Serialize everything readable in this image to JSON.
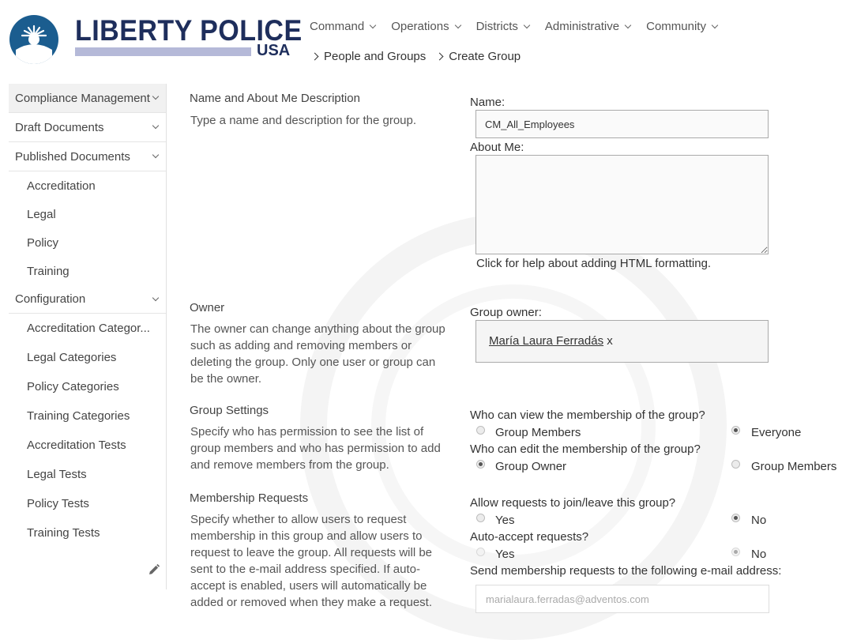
{
  "header": {
    "brand_title": "LIBERTY POLICE",
    "brand_sub": "USA",
    "nav": [
      {
        "label": "Command"
      },
      {
        "label": "Operations"
      },
      {
        "label": "Districts"
      },
      {
        "label": "Administrative"
      },
      {
        "label": "Community"
      }
    ],
    "breadcrumb": [
      {
        "label": "People and Groups"
      },
      {
        "label": "Create Group"
      }
    ]
  },
  "sidebar": {
    "compliance": "Compliance Management",
    "draft": "Draft Documents",
    "published": "Published Documents",
    "published_items": [
      {
        "label": "Accreditation"
      },
      {
        "label": "Legal"
      },
      {
        "label": "Policy"
      },
      {
        "label": "Training"
      }
    ],
    "configuration": "Configuration",
    "config_items": [
      {
        "label": "Accreditation Categor..."
      },
      {
        "label": "Legal Categories"
      },
      {
        "label": "Policy Categories"
      },
      {
        "label": "Training Categories"
      },
      {
        "label": "Accreditation Tests"
      },
      {
        "label": "Legal Tests"
      },
      {
        "label": "Policy Tests"
      },
      {
        "label": "Training Tests"
      }
    ]
  },
  "sections": {
    "name": {
      "title": "Name and About Me Description",
      "desc": "Type a name and description for the group."
    },
    "owner": {
      "title": "Owner",
      "desc": "The owner can change anything about the group such as adding and removing members or deleting the group. Only one user or group can be the owner."
    },
    "settings": {
      "title": "Group Settings",
      "desc": "Specify who has permission to see the list of group members and who has permission to add and remove members from the group."
    },
    "requests": {
      "title": "Membership Requests",
      "desc": "Specify whether to allow users to request membership in this group and allow users to request to leave the group. All requests will be sent to the e-mail address specified. If auto-accept is enabled, users will automatically be added or removed when they make a request."
    }
  },
  "form": {
    "name_label": "Name:",
    "name_value": "CM_All_Employees",
    "about_label": "About Me:",
    "about_value": "",
    "help_link": "Click for help about adding HTML formatting.",
    "owner_label": "Group owner:",
    "owner_value": "María Laura Ferradás",
    "owner_remove": "x",
    "view_question": "Who can view the membership of the group?",
    "view_options": [
      "Group Members",
      "Everyone"
    ],
    "view_selected": "Everyone",
    "edit_question": "Who can edit the membership of the group?",
    "edit_options": [
      "Group Owner",
      "Group Members"
    ],
    "edit_selected": "Group Owner",
    "join_question": "Allow requests to join/leave this group?",
    "join_options": [
      "Yes",
      "No"
    ],
    "join_selected": "No",
    "auto_question": "Auto-accept requests?",
    "auto_options": [
      "Yes",
      "No"
    ],
    "auto_selected": "No",
    "email_label": "Send membership requests to the following e-mail address:",
    "email_value": "marialaura.ferradas@adventos.com"
  },
  "colors": {
    "brand_navy": "#1e2e5c",
    "logo_blue": "#1b5d8f",
    "brand_bar": "#b5b9d8"
  },
  "icons": {
    "logo": "statue-of-liberty-logo",
    "chevron": "chevron-down-icon",
    "breadcrumb": "chevron-right-icon",
    "edit": "pencil-icon"
  }
}
